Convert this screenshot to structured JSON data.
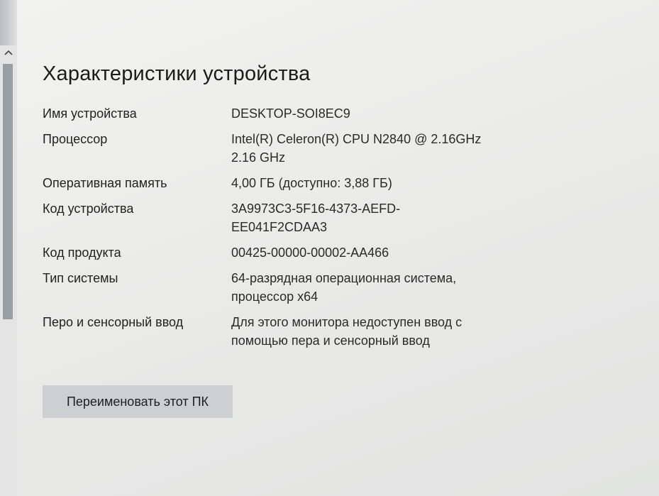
{
  "section": {
    "title": "Характеристики устройства"
  },
  "specs": [
    {
      "label": "Имя устройства",
      "value": [
        "DESKTOP-SOI8EC9"
      ]
    },
    {
      "label": "Процессор",
      "value": [
        "Intel(R) Celeron(R) CPU  N2840  @ 2.16GHz",
        "2.16 GHz"
      ]
    },
    {
      "label": "Оперативная память",
      "value": [
        "4,00 ГБ (доступно: 3,88 ГБ)"
      ]
    },
    {
      "label": "Код устройства",
      "value": [
        "3A9973C3-5F16-4373-AEFD-",
        "EE041F2CDAA3"
      ]
    },
    {
      "label": "Код продукта",
      "value": [
        "00425-00000-00002-AA466"
      ]
    },
    {
      "label": "Тип системы",
      "value": [
        "64-разрядная операционная система,",
        "процессор x64"
      ]
    },
    {
      "label": "Перо и сенсорный ввод",
      "value": [
        "Для этого монитора недоступен ввод с",
        "помощью пера и сенсорный ввод"
      ]
    }
  ],
  "actions": {
    "rename_label": "Переименовать этот ПК"
  },
  "icons": {
    "scroll_up": "chevron-up-icon"
  }
}
